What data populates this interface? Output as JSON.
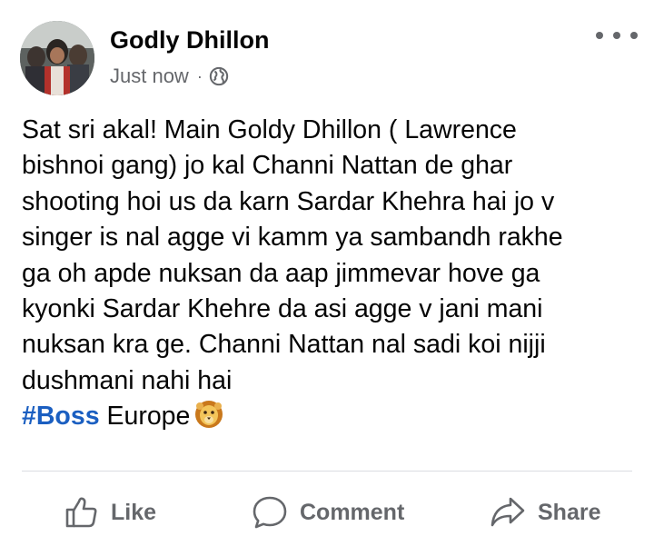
{
  "post": {
    "author": "Godly Dhillon",
    "timestamp": "Just now",
    "meta_separator": "·",
    "audience_icon": "globe-icon",
    "more_icon": "more-horizontal-icon",
    "text_lines": [
      "Sat sri akal! Main Goldy Dhillon ( Lawrence",
      "bishnoi gang) jo kal Channi Nattan de ghar",
      "shooting hoi us da karn Sardar Khehra hai jo v",
      "singer is nal agge vi kamm ya sambandh rakhe",
      "ga oh apde nuksan da aap jimmevar hove ga",
      "kyonki Sardar Khehre da asi agge v jani mani",
      "nuksan kra ge. Channi Nattan nal sadi koi nijji",
      "dushmani nahi hai"
    ],
    "hashtag": "#Boss",
    "tail_text": "Europe",
    "emoji": "lion-face-icon"
  },
  "actions": {
    "like_label": "Like",
    "comment_label": "Comment",
    "share_label": "Share"
  },
  "colors": {
    "text": "#050505",
    "secondary": "#65676b",
    "hashtag": "#1b5fc1",
    "divider": "#dadde1"
  }
}
